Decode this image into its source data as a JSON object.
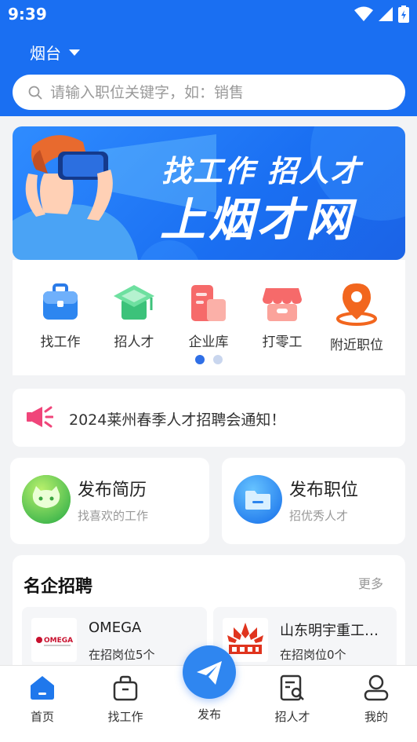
{
  "status_bar": {
    "time": "9:39"
  },
  "header": {
    "city": "烟台"
  },
  "search": {
    "placeholder": "请输入职位关键字，如：销售"
  },
  "banner": {
    "line1": "找工作 招人才",
    "line2": "上烟才网"
  },
  "quick_menu": [
    {
      "label": "找工作",
      "icon": "briefcase-icon"
    },
    {
      "label": "招人才",
      "icon": "graduation-cap-icon"
    },
    {
      "label": "企业库",
      "icon": "building-icon"
    },
    {
      "label": "打零工",
      "icon": "shop-icon"
    },
    {
      "label": "附近职位",
      "icon": "location-pin-icon"
    }
  ],
  "carousel": {
    "pages": 2,
    "active_page": 1
  },
  "notice": {
    "text": "2024莱州春季人才招聘会通知！"
  },
  "cards": [
    {
      "title": "发布简历",
      "subtitle": "找喜欢的工作"
    },
    {
      "title": "发布职位",
      "subtitle": "招优秀人才"
    }
  ],
  "companies": {
    "title": "名企招聘",
    "more": "更多",
    "items": [
      {
        "name": "OMEGA",
        "count": "在招岗位5个",
        "logo_text": "OMEGA"
      },
      {
        "name": "山东明宇重工…",
        "count": "在招岗位0个"
      }
    ]
  },
  "tabbar": {
    "items": [
      "首页",
      "找工作",
      "发布",
      "招人才",
      "我的"
    ],
    "active": "首页"
  },
  "colors": {
    "primary": "#1a6ff2",
    "accent_red": "#f5485a",
    "accent_green": "#3cc27a"
  }
}
